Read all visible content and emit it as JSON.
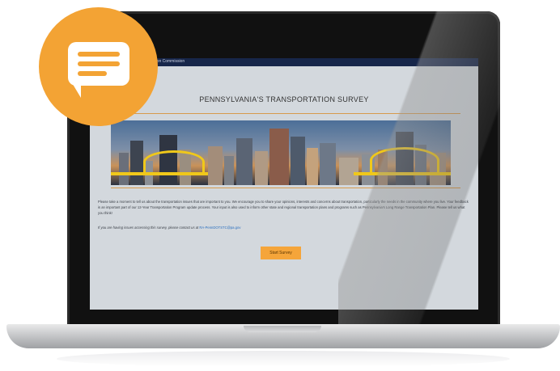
{
  "header": {
    "commission_label": "...Transportation Commission"
  },
  "survey": {
    "title": "PENNSYLVANIA'S TRANSPORTATION SURVEY",
    "paragraph": "Please take a moment to tell us about the transportation issues that are important to you. We encourage you to share your opinions, interests and concerns about transportation, particularly the needs in the community where you live. Your feedback is an important part of our 12-Year Transportation Program update process. Your input is also used to inform other state and regional transportation plans and programs such as Pennsylvania's Long Range Transportation Plan. Please tell us what you think!",
    "contact_text": "If you are having issues accessing this survey, please contact us at",
    "contact_email": "RA-PennDOTSTC@pa.gov",
    "start_button": "Start Survey"
  },
  "icons": {
    "chat_badge": "chat-bubble-icon"
  },
  "colors": {
    "accent_orange": "#f3a334",
    "topbar_navy": "#17264a",
    "screen_bg": "#d3d8dd"
  }
}
